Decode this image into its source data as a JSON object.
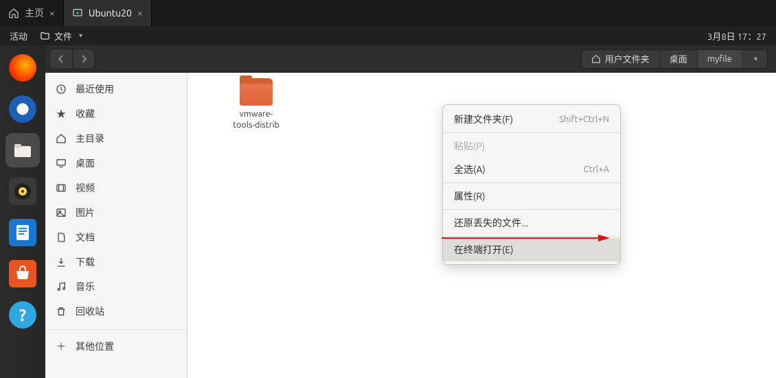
{
  "host": {
    "tab1": {
      "label": "主页"
    },
    "tab2": {
      "label": "Ubuntu20"
    }
  },
  "gnome": {
    "activities": "活动",
    "files_label": "文件",
    "datetime": "3月8日 17：27"
  },
  "path": {
    "home": "用户文件夹",
    "desktop": "桌面",
    "current": "myfile"
  },
  "sidebar": {
    "items": [
      {
        "label": "最近使用",
        "icon": "clock"
      },
      {
        "label": "收藏",
        "icon": "star"
      },
      {
        "label": "主目录",
        "icon": "home"
      },
      {
        "label": "桌面",
        "icon": "desktop"
      },
      {
        "label": "视频",
        "icon": "video"
      },
      {
        "label": "图片",
        "icon": "image"
      },
      {
        "label": "文档",
        "icon": "doc"
      },
      {
        "label": "下载",
        "icon": "download"
      },
      {
        "label": "音乐",
        "icon": "music"
      },
      {
        "label": "回收站",
        "icon": "trash"
      }
    ],
    "other": "其他位置"
  },
  "files": {
    "folder1": "vmware-tools-distrib"
  },
  "context": {
    "new_folder": "新建文件夹(F)",
    "new_folder_short": "Shift+Ctrl+N",
    "paste": "粘贴(P)",
    "select_all": "全选(A)",
    "select_all_short": "Ctrl+A",
    "properties": "属性(R)",
    "restore": "还原丢失的文件...",
    "terminal": "在终端打开(E)"
  }
}
